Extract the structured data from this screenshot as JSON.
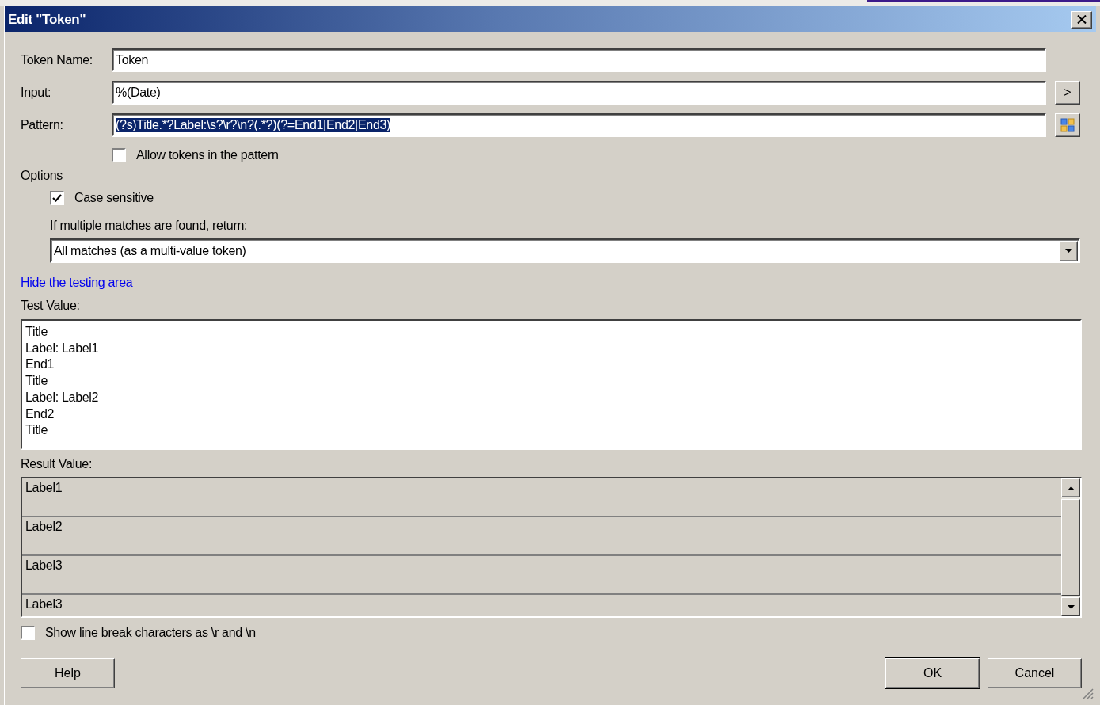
{
  "window": {
    "title": "Edit \"Token\""
  },
  "fields": [
    {
      "label": "Token Name:",
      "value": "Token",
      "kind": "text",
      "text_selected": false
    },
    {
      "label": "Input:",
      "value": "%(Date)",
      "kind": "insert",
      "button": ">",
      "text_selected": false
    },
    {
      "label": "Pattern:",
      "value": "(?s)Title.*?Label:\\s?\\r?\\n?(.*?)(?=End1|End2|End3)",
      "kind": "builder",
      "text_selected": true
    }
  ],
  "allow_tokens": {
    "label": "Allow tokens in the pattern",
    "checked": false
  },
  "options": {
    "title": "Options",
    "case_sensitive": {
      "label": "Case sensitive",
      "checked": true
    },
    "multiple_label": "If multiple matches are found, return:",
    "dropdown_value": "All matches (as a multi-value token)"
  },
  "testing_link": "Hide the testing area",
  "test_value": {
    "label": "Test Value:",
    "lines": [
      "Title",
      "Label: Label1",
      "End1",
      "Title",
      "Label: Label2",
      "End2",
      "Title"
    ]
  },
  "result_value": {
    "label": "Result Value:",
    "items": [
      "Label1",
      "Label2",
      "Label3",
      "Label3"
    ]
  },
  "show_line_breaks": {
    "label": "Show line break characters as \\r and \\n",
    "checked": false
  },
  "buttons": [
    {
      "label": "Help",
      "kind": "help",
      "default": false
    },
    {
      "label": "OK",
      "kind": "ok",
      "default": true
    },
    {
      "label": "Cancel",
      "kind": "cancel",
      "default": false
    }
  ]
}
